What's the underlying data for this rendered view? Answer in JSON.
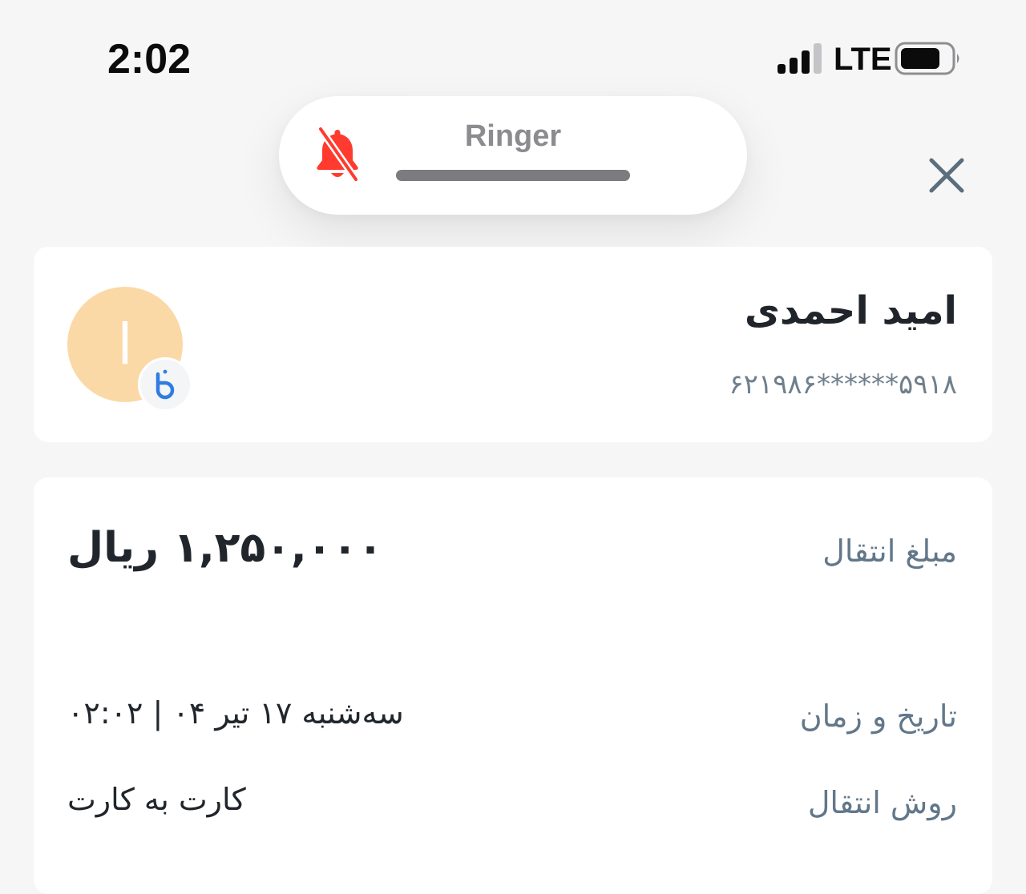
{
  "status_bar": {
    "time": "2:02",
    "network": "LTE",
    "signal_icon": "cellular-signal-icon",
    "battery_icon": "battery-icon"
  },
  "ringer_hud": {
    "label": "Ringer",
    "icon": "bell-slash-icon",
    "icon_color": "#ff3b30",
    "volume_fraction": 1.0
  },
  "header": {
    "close_icon": "close-icon"
  },
  "recipient": {
    "name": "امید احمدی",
    "card_number": "۶۲۱۹۸۶******۵۹۱۸",
    "avatar_initial": "ا",
    "avatar_color": "#fad9a6",
    "bank_icon": "bank-logo-icon",
    "bank_color": "#2f7de1"
  },
  "details": {
    "amount": {
      "label": "مبلغ انتقال",
      "value": "۱,۲۵۰,۰۰۰ ریال"
    },
    "datetime": {
      "label": "تاریخ و زمان",
      "value": "سه‌شنبه ۱۷ تیر ۰۴ | ۰۲:۰۲"
    },
    "method": {
      "label": "روش انتقال",
      "value": "کارت به کارت"
    }
  }
}
